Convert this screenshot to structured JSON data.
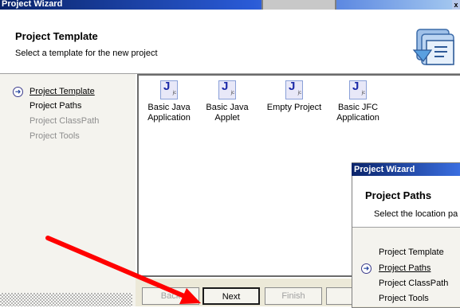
{
  "window": {
    "title": "Project Wizard",
    "close_glyph": "x"
  },
  "header": {
    "title": "Project Template",
    "subtitle": "Select a template for the new project"
  },
  "sidebar": {
    "items": [
      {
        "label": "Project Template"
      },
      {
        "label": "Project Paths"
      },
      {
        "label": "Project ClassPath"
      },
      {
        "label": "Project Tools"
      }
    ]
  },
  "templates": [
    {
      "label": "Basic Java Application"
    },
    {
      "label": "Basic Java Applet"
    },
    {
      "label": "Empty Project"
    },
    {
      "label": "Basic JFC Application"
    }
  ],
  "icon_letters": {
    "main": "J",
    "sub": "jc"
  },
  "buttons": {
    "back": "Back",
    "next": "Next",
    "finish": "Finish"
  },
  "wizard2": {
    "title": "Project Wizard",
    "header_title": "Project Paths",
    "header_subtitle": "Select the location pa",
    "items": [
      {
        "label": "Project Template"
      },
      {
        "label": "Project Paths"
      },
      {
        "label": "Project ClassPath"
      },
      {
        "label": "Project Tools"
      }
    ]
  },
  "colors": {
    "annotation_arrow": "#ff0000"
  }
}
